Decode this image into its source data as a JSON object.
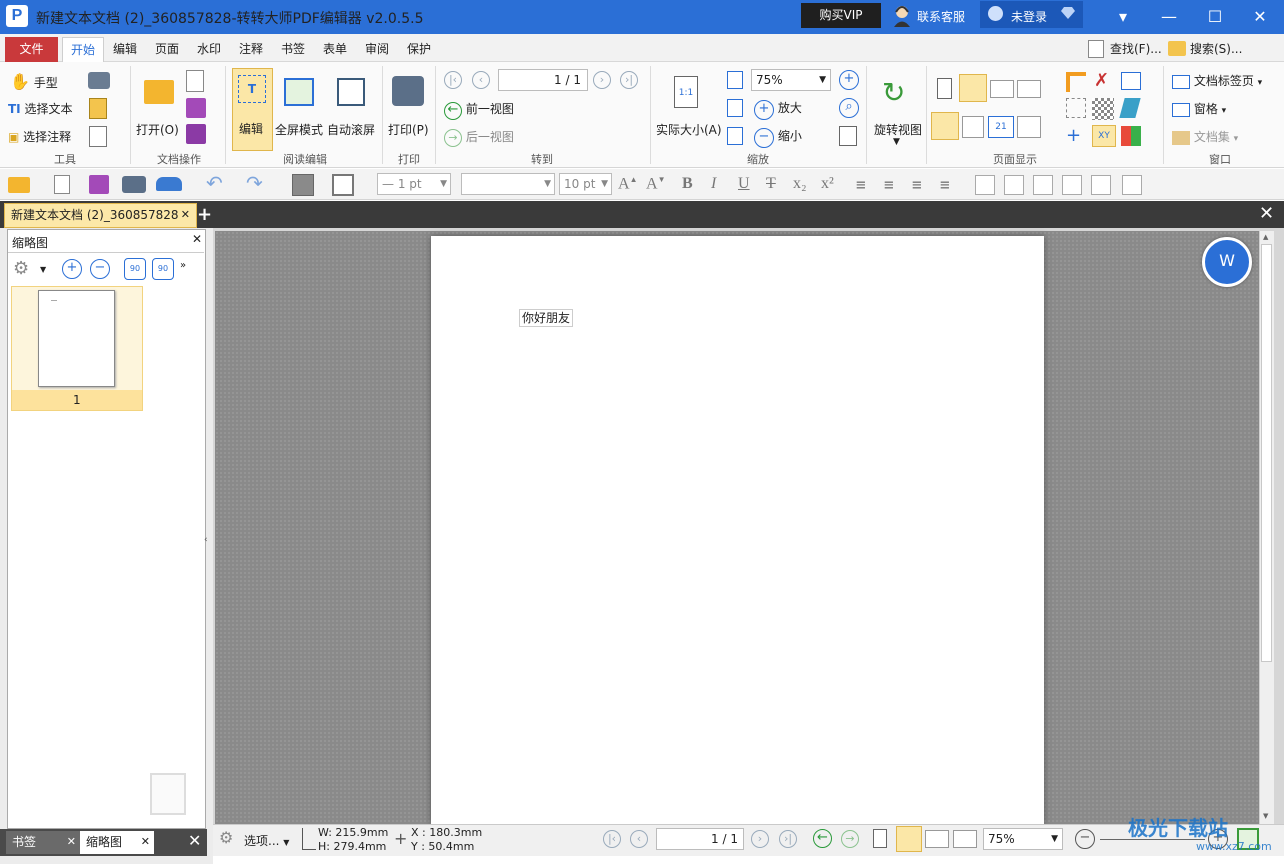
{
  "window": {
    "title": "新建文本文档 (2)_360857828-转转大师PDF编辑器 v2.0.5.5",
    "app_icon": "P",
    "vip_button": "购买VIP",
    "service_link": "联系客服",
    "user_label": "未登录",
    "controls": {
      "menu": "▾",
      "minimize": "—",
      "maximize": "☐",
      "close": "✕"
    }
  },
  "menu": {
    "file": "文件",
    "tabs": [
      "开始",
      "编辑",
      "页面",
      "水印",
      "注释",
      "书签",
      "表单",
      "审阅",
      "保护"
    ],
    "active_tab": "开始",
    "find": "查找(F)...",
    "search": "搜索(S)..."
  },
  "ribbon": {
    "tools": {
      "hand": "手型",
      "select_text": "选择文本",
      "select_annotation": "选择注释",
      "label": "工具"
    },
    "doc_ops": {
      "open": "打开(O)",
      "label": "文档操作"
    },
    "read_edit": {
      "edit": "编辑",
      "fullscreen": "全屏模式",
      "autoscroll": "自动滚屏",
      "label": "阅读编辑"
    },
    "print": {
      "print": "打印(P)",
      "label": "打印"
    },
    "goto": {
      "page_value": "1 / 1",
      "prev_view": "前一视图",
      "next_view": "后一视图",
      "label": "转到"
    },
    "zoom": {
      "actual_size": "实际大小(A)",
      "actual_icon": "1:1",
      "zoom_value": "75%",
      "zoom_in": "放大",
      "zoom_out": "缩小",
      "label": "缩放"
    },
    "rotate": {
      "rotate_view": "旋转视图"
    },
    "page_display": {
      "label": "页面显示"
    },
    "window": {
      "doc_tabs": "文档标签页",
      "panes": "窗格",
      "doc_set": "文档集",
      "label": "窗口"
    }
  },
  "quickbar": {
    "line_width": "1 pt",
    "font_name": "",
    "font_size": "10 pt",
    "format_glyphs": [
      "B",
      "I",
      "U",
      "T",
      "x₂",
      "x²"
    ]
  },
  "doc_tab": {
    "name": "新建文本文档 (2)_360857828",
    "close": "✕",
    "new": "+"
  },
  "left_panel": {
    "title": "缩略图",
    "close": "✕",
    "thumb_page_number": "1",
    "tabs": [
      {
        "label": "书签",
        "close": "✕"
      },
      {
        "label": "缩略图",
        "close": "✕"
      }
    ],
    "rotate_left": "90",
    "rotate_right": "90"
  },
  "document": {
    "text_box": "你好朋友"
  },
  "status": {
    "options": "选项...",
    "width": "W: 215.9mm",
    "height": "H: 279.4mm",
    "x": "X :  180.3mm",
    "y": "Y :    50.4mm",
    "page_value": "1 / 1",
    "zoom_value": "75%"
  },
  "watermark": {
    "text": "极光下载站",
    "url": "www.xz7.com"
  },
  "colors": {
    "title_bar": "#2b6fd6",
    "file_tab": "#c9393b",
    "accent_highlight": "#fbe7a7"
  }
}
